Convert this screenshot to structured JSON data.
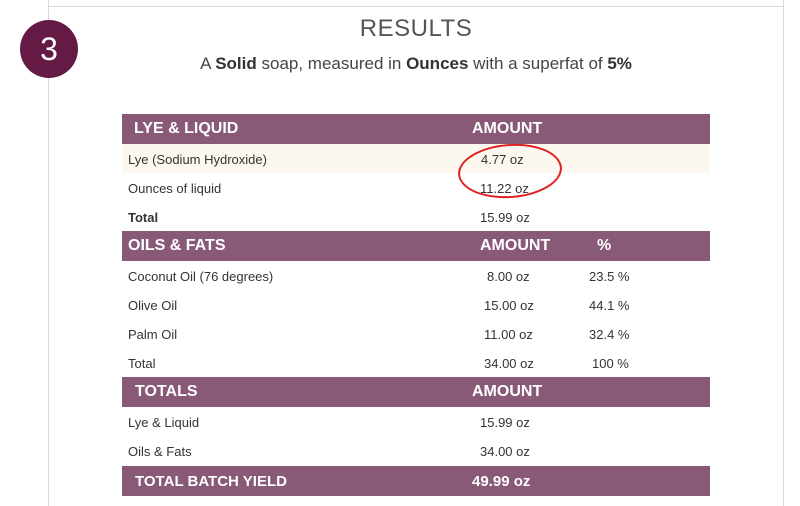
{
  "step_number": "3",
  "title": "RESULTS",
  "summary": {
    "prefix": "A ",
    "soap_type": "Solid",
    "middle": " soap, measured in ",
    "unit": "Ounces",
    "superfat_text": " with a superfat of ",
    "superfat": "5%"
  },
  "lye_liquid": {
    "header": "LYE & LIQUID",
    "amount_header": "AMOUNT",
    "rows": [
      {
        "label": "Lye (Sodium Hydroxide)",
        "amount": "4.77 oz"
      },
      {
        "label": "Ounces of liquid",
        "amount": "11.22 oz"
      }
    ],
    "total_label": "Total",
    "total_amount": "15.99 oz"
  },
  "oils_fats": {
    "header": "OILS & FATS",
    "amount_header": "AMOUNT",
    "pct_header": "%",
    "rows": [
      {
        "label": "Coconut Oil (76 degrees)",
        "amount": "8.00 oz",
        "pct": "23.5 %"
      },
      {
        "label": "Olive Oil",
        "amount": "15.00 oz",
        "pct": "44.1 %"
      },
      {
        "label": "Palm Oil",
        "amount": "11.00 oz",
        "pct": "32.4 %"
      }
    ],
    "total_label": "Total",
    "total_amount": "34.00 oz",
    "total_pct": "100 %"
  },
  "totals": {
    "header": "TOTALS",
    "amount_header": "AMOUNT",
    "rows": [
      {
        "label": "Lye & Liquid",
        "amount": "15.99 oz"
      },
      {
        "label": "Oils & Fats",
        "amount": "34.00 oz"
      }
    ]
  },
  "batch_yield": {
    "label": "TOTAL BATCH YIELD",
    "amount": "49.99 oz"
  },
  "colors": {
    "badge": "#651a46",
    "header_bg": "#885a78",
    "row_cream": "#fdf8ef",
    "annotation": "#e02020"
  }
}
